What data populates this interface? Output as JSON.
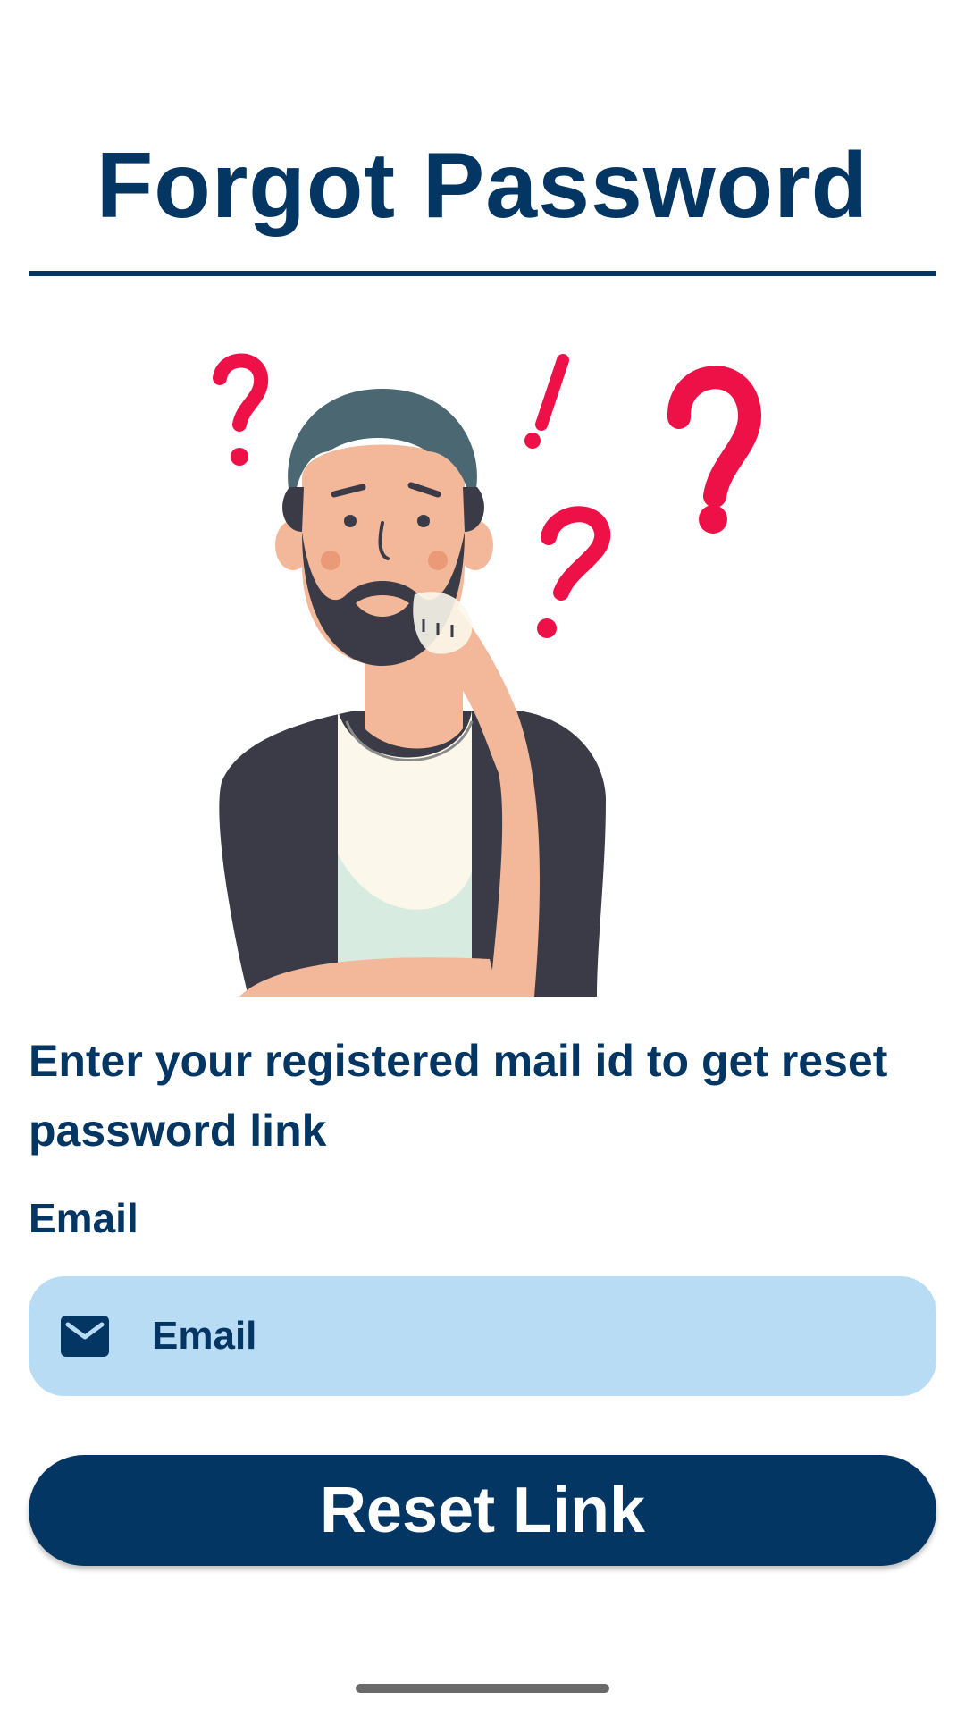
{
  "header": {
    "title": "Forgot Password"
  },
  "illustration": {
    "name": "confused-man-illustration",
    "accent_color": "#ed1147"
  },
  "main": {
    "instructions": "Enter your registered mail id to get reset password link",
    "email_label": "Email",
    "email_field": {
      "value": "",
      "placeholder": "Email",
      "icon": "mail-icon"
    },
    "reset_button_label": "Reset Link"
  },
  "colors": {
    "primary": "#033663",
    "field_background": "#b9dcf5",
    "background": "#ffffff"
  }
}
